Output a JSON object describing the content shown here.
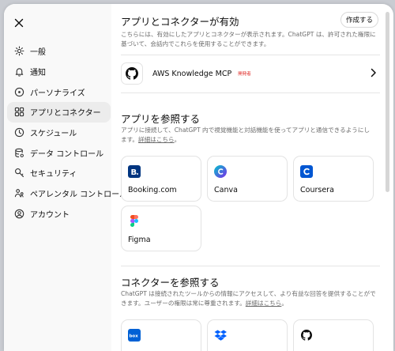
{
  "sidebar": {
    "close_label": "×",
    "items": [
      {
        "label": "一般",
        "icon": "gear-icon"
      },
      {
        "label": "通知",
        "icon": "bell-icon"
      },
      {
        "label": "パーソナライズ",
        "icon": "personalize-icon"
      },
      {
        "label": "アプリとコネクター",
        "icon": "apps-icon"
      },
      {
        "label": "スケジュール",
        "icon": "clock-icon"
      },
      {
        "label": "データ コントロール",
        "icon": "database-icon"
      },
      {
        "label": "セキュリティ",
        "icon": "key-icon"
      },
      {
        "label": "ペアレンタル コントロール",
        "icon": "family-icon"
      },
      {
        "label": "アカウント",
        "icon": "user-circle-icon"
      }
    ],
    "active_index": 3
  },
  "enabled": {
    "title": "アプリとコネクターが有効",
    "button_label": "作成する",
    "description": "こちらには、有効にしたアプリとコネクターが表示されます。ChatGPT は、許可された権限に基づいて、会話内でこれらを使用することができます。",
    "connector": {
      "name": "AWS Knowledge MCP",
      "badge": "開発者"
    }
  },
  "browse_apps": {
    "title": "アプリを参照する",
    "description": "アプリに接続して、ChatGPT 内で視覚機能と対話機能を使ってアプリと通信できるようにします。",
    "link": "詳細はこちら",
    "suffix": "。",
    "apps": [
      {
        "name": "Booking.com",
        "icon": "booking-logo",
        "color": "#003580"
      },
      {
        "name": "Canva",
        "icon": "canva-logo",
        "color": "#7d2ae8"
      },
      {
        "name": "Coursera",
        "icon": "coursera-logo",
        "color": "#0056d2"
      },
      {
        "name": "Figma",
        "icon": "figma-logo",
        "color": "#f24e1e"
      }
    ]
  },
  "browse_connectors": {
    "title": "コネクターを参照する",
    "description": "ChatGPT は接続されたツールからの情報にアクセスして、より有益な回答を提供することができます。ユーザーの権限は常に尊重されます。",
    "link": "詳細はこちら",
    "suffix": "。",
    "connectors": [
      {
        "icon": "box-logo",
        "label": "box",
        "color": "#0061d5"
      },
      {
        "icon": "dropbox-logo",
        "color": "#0061fe"
      },
      {
        "icon": "github-logo",
        "color": "#0d0d0d"
      }
    ]
  }
}
